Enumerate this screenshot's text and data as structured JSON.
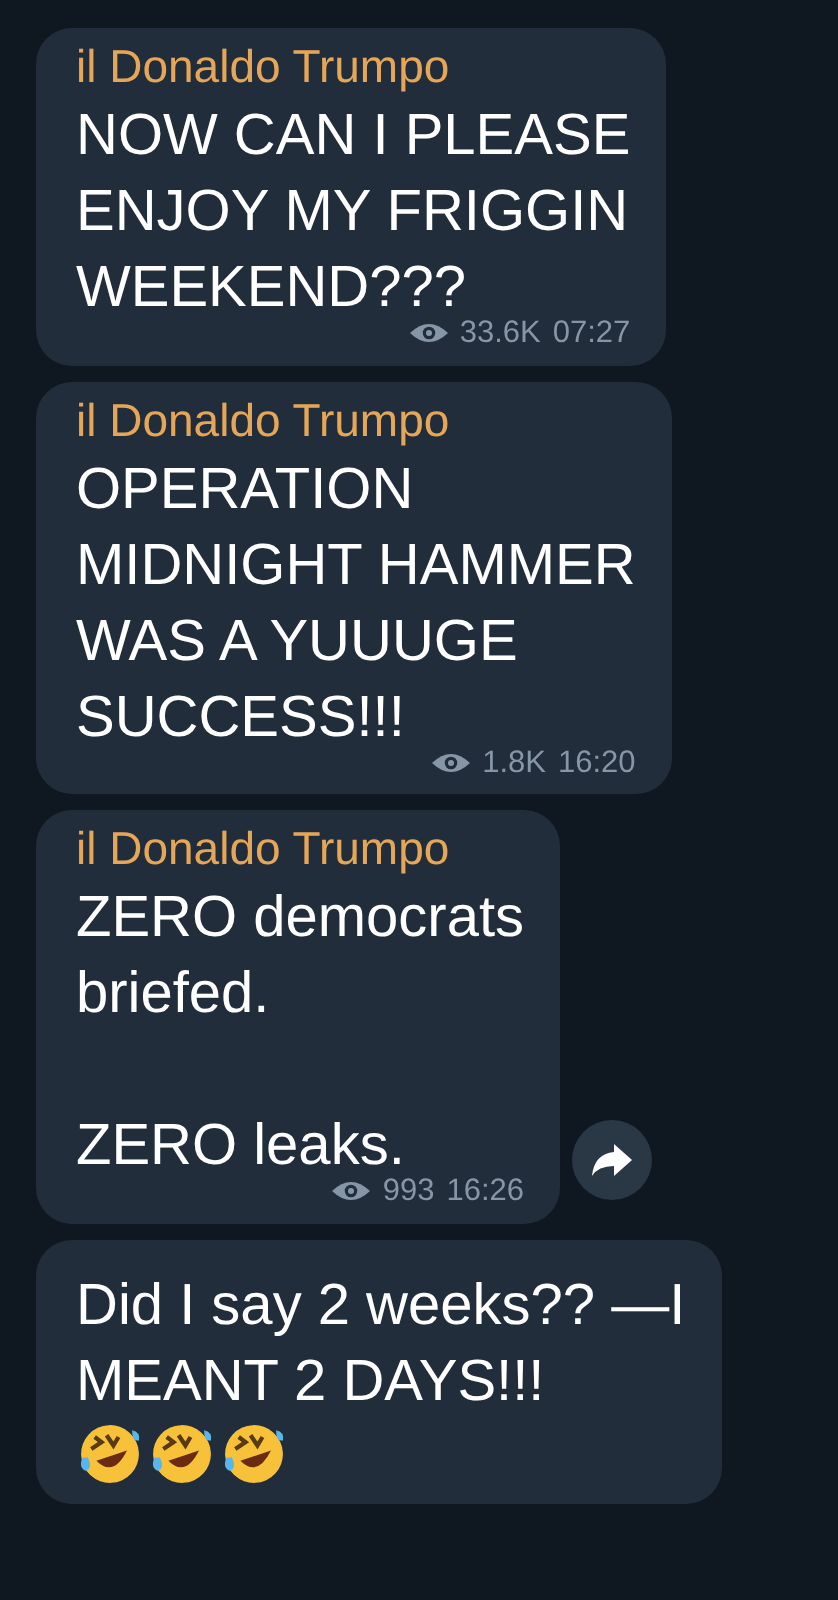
{
  "messages": [
    {
      "sender": "il Donaldo Trumpo",
      "text": "NOW CAN I PLEASE\nENJOY MY FRIGGIN\nWEEKEND???",
      "views": "33.6K",
      "time": "07:27"
    },
    {
      "sender": "il Donaldo Trumpo",
      "text": "OPERATION\nMIDNIGHT HAMMER\nWAS A YUUUGE\nSUCCESS!!!",
      "views": "1.8K",
      "time": "16:20"
    },
    {
      "sender": "il Donaldo Trumpo",
      "text": "ZERO democrats\nbriefed.\n\nZERO leaks.",
      "views": "993",
      "time": "16:26",
      "share": true
    },
    {
      "text": "Did I say 2 weeks??  —I\nMEANT 2 DAYS!!!",
      "emojis": [
        {
          "kind": "rolling-laughing"
        },
        {
          "kind": "rolling-laughing"
        },
        {
          "kind": "rolling-laughing"
        }
      ]
    }
  ]
}
